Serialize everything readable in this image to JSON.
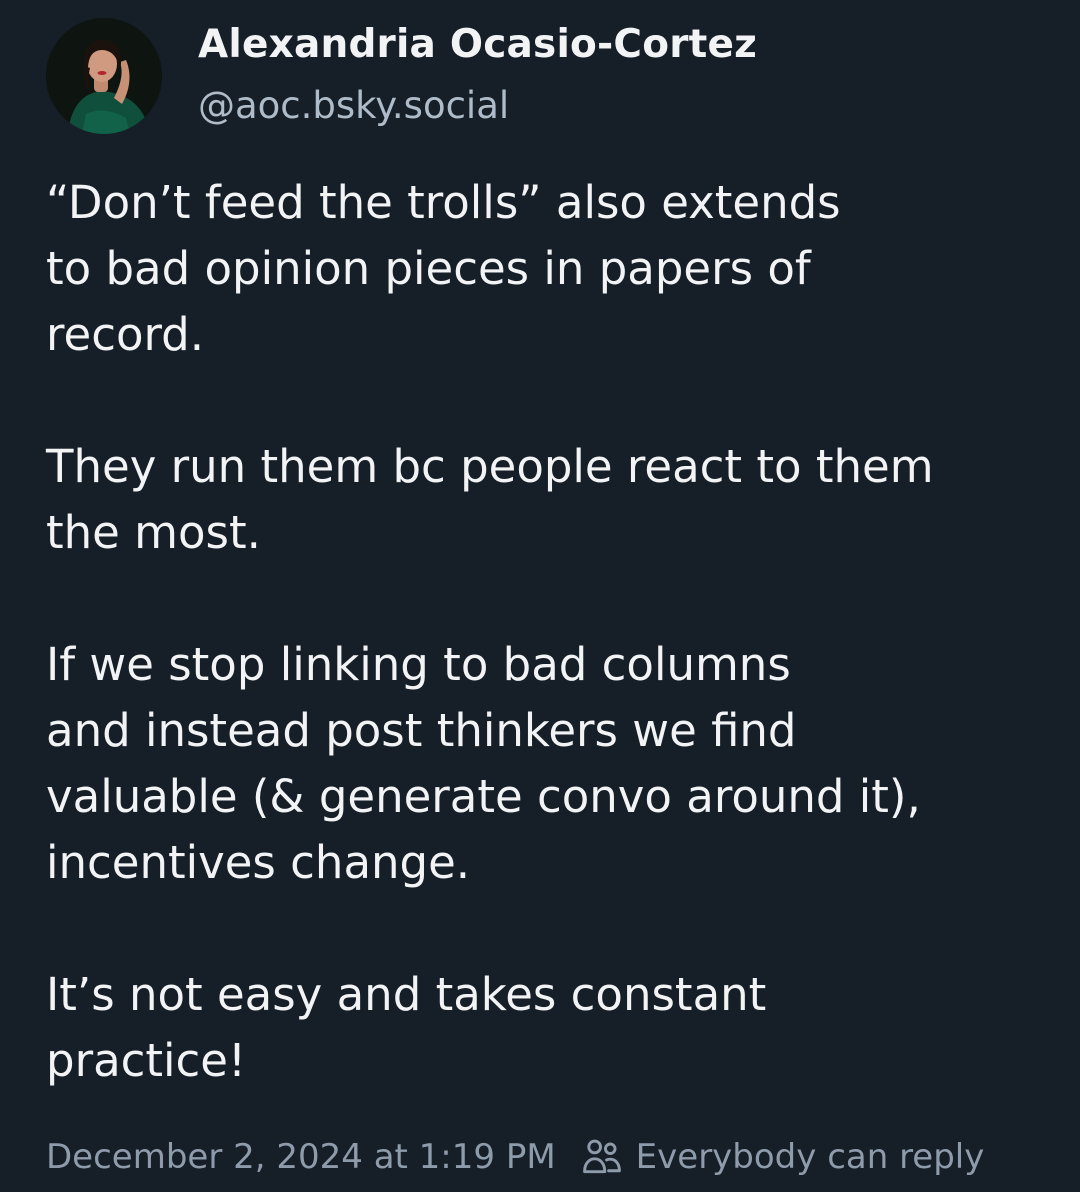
{
  "author": {
    "display_name": "Alexandria Ocasio-Cortez",
    "handle": "@aoc.bsky.social",
    "avatar_icon": "profile-photo"
  },
  "post": {
    "text": "“Don’t feed the trolls” also extends\nto bad opinion pieces in papers of\nrecord.\n\nThey run them bc people react to them\nthe most.\n\nIf we stop linking to bad columns\nand instead post thinkers we find\nvaluable (& generate convo around it),\nincentives change.\n\nIt’s not easy and takes constant\npractice!"
  },
  "footer": {
    "timestamp": "December 2, 2024 at 1:19 PM",
    "reply_setting": "Everybody can reply",
    "reply_icon": "people-icon"
  },
  "colors": {
    "background": "#161e27",
    "text_primary": "#f1f3f5",
    "text_secondary": "#aebbc9",
    "text_muted": "#8e9bab"
  }
}
